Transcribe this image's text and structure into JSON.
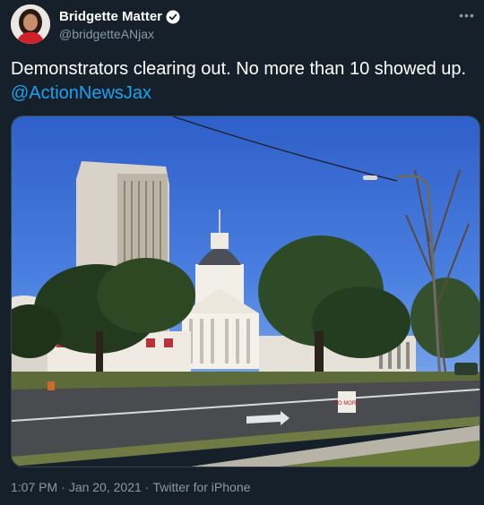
{
  "author": {
    "display_name": "Bridgette Matter",
    "handle": "@bridgetteANjax",
    "verified": true,
    "avatar_icon": "profile-photo"
  },
  "more_icon": "more-icon",
  "more_glyph": "•••",
  "tweet": {
    "text": "Demonstrators clearing out. No more than 10 showed up. ",
    "mention": "@ActionNewsJax"
  },
  "media": {
    "sign_text": "NO MORE"
  },
  "meta": {
    "time": "1:07 PM",
    "dot1": "·",
    "date": "Jan 20, 2021",
    "dot2": "·",
    "source": "Twitter for iPhone"
  },
  "colors": {
    "background": "#15202b",
    "accent": "#1da1f2",
    "muted": "#8899a6",
    "verified": "#ffffff"
  }
}
